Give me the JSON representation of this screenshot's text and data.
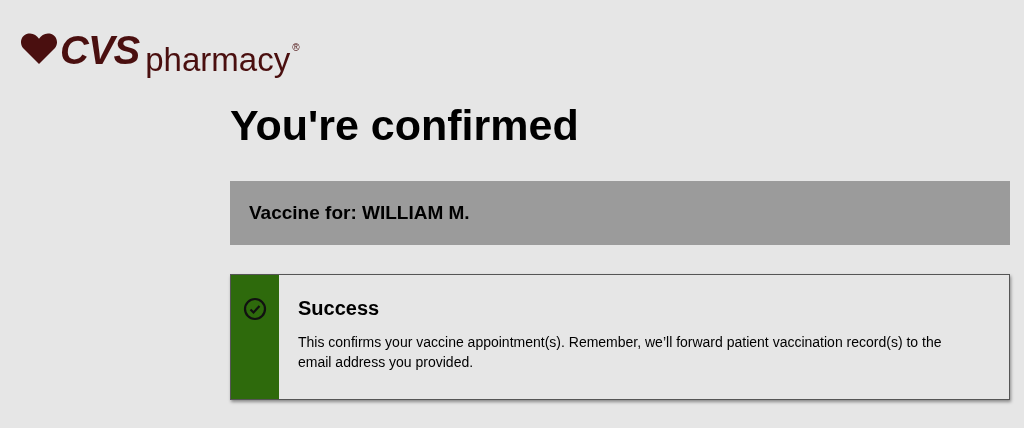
{
  "logo": {
    "brand": "CVS",
    "product": "pharmacy",
    "mark": "®"
  },
  "heading": "You're confirmed",
  "patient_bar": {
    "text": "Vaccine for: WILLIAM M."
  },
  "alert": {
    "kind": "success",
    "title": "Success",
    "message": "This confirms your vaccine appointment(s). Remember, we’ll forward patient vaccination record(s) to the email address you provided."
  }
}
